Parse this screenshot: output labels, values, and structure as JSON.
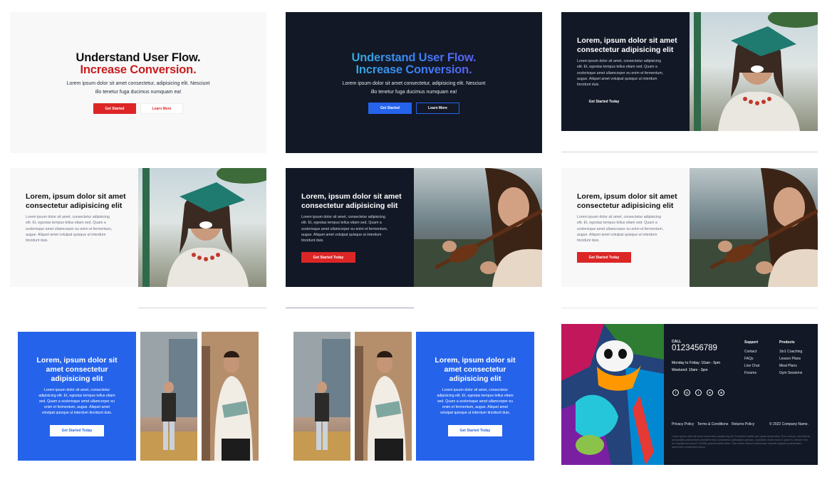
{
  "templates": {
    "hero_light": {
      "title_line1": "Understand User Flow.",
      "title_line2": "Increase Conversion.",
      "text_line1": "Lorem ipsum dolor sit amet consectetur, adipisicing elit. Nesciunt",
      "text_line2": "illo tenetur fuga ducimus numquam ea!",
      "primary_button": "Get Started",
      "secondary_button": "Learn More"
    },
    "hero_dark": {
      "title_line1": "Understand User Flow.",
      "title_line2": "Increase Conversion.",
      "text_line1": "Lorem ipsum dolor sit amet consectetur, adipisicing elit. Nesciunt",
      "text_line2": "illo tenetur fuga ducimus numquam ea!",
      "primary_button": "Get Started",
      "secondary_button": "Learn More"
    },
    "split_common": {
      "title_line1": "Lorem, ipsum dolor sit amet",
      "title_line2": "consectetur adipisicing elit",
      "text_line1": "Lorem ipsum dolor sit amet, consectetur adipisicing",
      "text_line2": "elit. Et, egestas tempus tellus etiam sed. Quam a",
      "text_line3": "scelerisque amet ullamcorper eu enim et fermentum,",
      "text_line4": "augue. Aliquet amet volutpat quisque ut interdum",
      "text_line5": "tincidunt duis.",
      "cta": "Get Started Today"
    },
    "blue_split": {
      "title_line1": "Lorem, ipsum dolor sit",
      "title_line2": "amet consectetur",
      "title_line3": "adipisicing elit",
      "text_line1": "Lorem ipsum dolor sit amet, consectetur",
      "text_line2": "adipisicing elit. Et, egestas tempus tellus etiam",
      "text_line3": "sed. Quam a scelerisque amet ullamcorper eu",
      "text_line4": "enim et fermentum, augue. Aliquet amet",
      "text_line5": "volutpat quisque ut interdum tincidunt duis.",
      "cta": "Get Started Today"
    },
    "footer": {
      "call_label": "CALL",
      "phone": "0123456789",
      "hours_line1": "Monday to Friday: 10am - 5pm",
      "hours_line2": "Weekend: 10am - 3pm",
      "support_heading": "Support",
      "support_links": [
        "Contact",
        "FAQs",
        "Live Chat",
        "Forums"
      ],
      "products_heading": "Products",
      "products_links": [
        "1to1 Coaching",
        "Lesson Plans",
        "Meal Plans",
        "Gym Sessions"
      ],
      "legal_links": [
        "Privacy Policy",
        "Terms & Conditions",
        "Returns Policy"
      ],
      "copyright": "© 2022 Company Name.",
      "small_print": "Lorem ipsum dolor sit amet consectetur adipisicing elit. Provident mollitia quo quasi repellendus. Porro harum, odit dolores perspiciatis praesentium provident esse consectetur quibusdam aperiam, cupiditate omnis modi in quas! In, veniam vero vel repellat sed earum? Debitis quaerat facilis animi. Odio natus nostrum laboriosam impedit magnam praesentium asperiores consectetur ipsum."
    }
  },
  "colors": {
    "red": "#dc2626",
    "blue": "#2563eb",
    "dark": "#121826",
    "light": "#f8f8f9",
    "gradient_start": "#2dd4bf",
    "gradient_mid": "#3b82f6",
    "gradient_end": "#7c3aed"
  },
  "icons": [
    "facebook-icon",
    "instagram-icon",
    "twitter-icon",
    "github-icon",
    "dribbble-icon"
  ]
}
